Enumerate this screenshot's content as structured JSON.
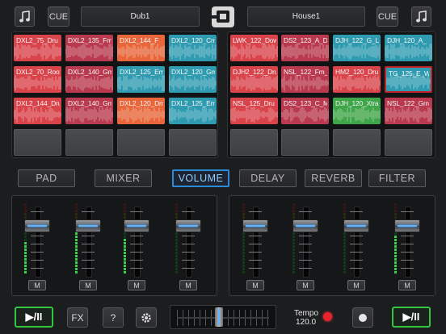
{
  "decks": {
    "left": {
      "title": "Dub1",
      "cue_label": "CUE",
      "music_icon": "music-note-icon"
    },
    "right": {
      "title": "House1",
      "cue_label": "CUE",
      "music_icon": "music-note-icon"
    }
  },
  "logo_icon": "app-logo-icon",
  "pads_left": [
    [
      {
        "label": "DXL2_75_Dru",
        "color": "#d9434a"
      },
      {
        "label": "DXL2_135_Fm",
        "color": "#b93a4e"
      },
      {
        "label": "DXL2_144_F",
        "color": "#e8663a"
      },
      {
        "label": "DXL2_120_Cm",
        "color": "#2f9bb0"
      }
    ],
    [
      {
        "label": "DXL2_70_Root",
        "color": "#d9434a"
      },
      {
        "label": "DXL2_140_Gm",
        "color": "#b93a4e"
      },
      {
        "label": "DXL2_125_Em",
        "color": "#2f9bb0"
      },
      {
        "label": "DXL2_120_Gm",
        "color": "#2f9bb0"
      }
    ],
    [
      {
        "label": "DXL2_144_Dru",
        "color": "#d9434a"
      },
      {
        "label": "DXL2_140_Gm",
        "color": "#b93a4e"
      },
      {
        "label": "DXL2_120_Dm",
        "color": "#e8663a"
      },
      {
        "label": "DXL2_125_Em",
        "color": "#2f9bb0"
      }
    ],
    [
      null,
      null,
      null,
      null
    ]
  ],
  "pads_right": [
    [
      {
        "label": "LWK_122_Dow",
        "color": "#d9434a"
      },
      {
        "label": "DS2_123_A_D",
        "color": "#b93a4e"
      },
      {
        "label": "DJH_122_G_L",
        "color": "#2f9bb0"
      },
      {
        "label": "DJH_120_A_",
        "color": "#2f9bb0"
      }
    ],
    [
      {
        "label": "DJH2_122_Dru",
        "color": "#d9434a"
      },
      {
        "label": "NSL_122_Fm_",
        "color": "#b93a4e"
      },
      {
        "label": "HM2_120_Dru",
        "color": "#d9434a"
      },
      {
        "label": "TG_125_E_Wi",
        "color": "#2f9bb0",
        "selected": true
      }
    ],
    [
      {
        "label": "NSL_125_Dru",
        "color": "#d9434a"
      },
      {
        "label": "DS2_123_C_M",
        "color": "#b93a4e"
      },
      {
        "label": "DJH_120_Xtra",
        "color": "#3fa549"
      },
      {
        "label": "NSL_122_Gm",
        "color": "#b93a4e"
      }
    ],
    [
      null,
      null,
      null,
      null
    ]
  ],
  "tabs": [
    {
      "label": "PAD",
      "active": false
    },
    {
      "label": "MIXER",
      "active": false
    },
    {
      "label": "VOLUME",
      "active": true
    },
    {
      "label": "DELAY",
      "active": false
    },
    {
      "label": "REVERB",
      "active": false
    },
    {
      "label": "FILTER",
      "active": false
    }
  ],
  "channels": {
    "mute_label": "M",
    "left": [
      {
        "level": 0.45
      },
      {
        "level": 0.6
      },
      {
        "level": 0.5
      },
      {
        "level": 0.0
      }
    ],
    "right": [
      {
        "level": 0.0
      },
      {
        "level": 0.0
      },
      {
        "level": 0.0
      },
      {
        "level": 0.55
      }
    ]
  },
  "transport": {
    "play_label": "▶/II",
    "fx_label": "FX",
    "help_label": "?",
    "settings_icon": "gear-icon",
    "tempo_label": "Tempo",
    "tempo_value": "120.0",
    "record_icon": "record-icon",
    "stop_icon": "stop-icon",
    "crossfader_position": 0.45
  }
}
